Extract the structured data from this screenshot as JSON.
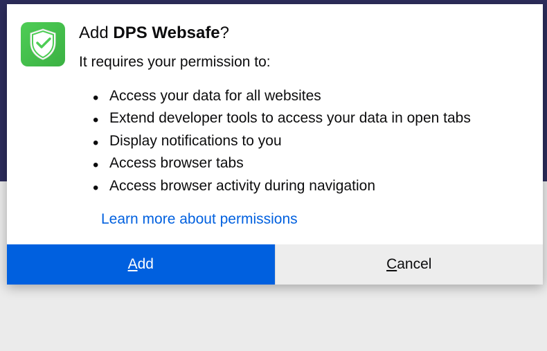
{
  "dialog": {
    "title_prefix": "Add ",
    "title_extension": "DPS Websafe",
    "title_suffix": "?",
    "permission_intro": "It requires your permission to:",
    "permissions": [
      "Access your data for all websites",
      "Extend developer tools to access your data in open tabs",
      "Display notifications to you",
      "Access browser tabs",
      "Access browser activity during navigation"
    ],
    "learn_more": "Learn more about permissions",
    "buttons": {
      "add_first": "A",
      "add_rest": "dd",
      "cancel_first": "C",
      "cancel_rest": "ancel"
    }
  },
  "icon": {
    "name": "shield-check-icon"
  }
}
